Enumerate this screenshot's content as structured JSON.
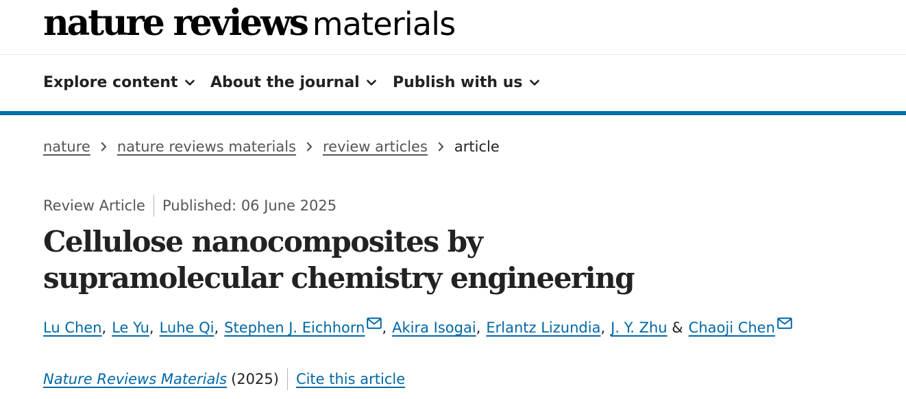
{
  "logo": {
    "main": "nature reviews",
    "sub": "materials"
  },
  "nav": [
    {
      "label": "Explore content"
    },
    {
      "label": "About the journal"
    },
    {
      "label": "Publish with us"
    }
  ],
  "breadcrumbs": [
    {
      "label": "nature"
    },
    {
      "label": "nature reviews materials"
    },
    {
      "label": "review articles"
    },
    {
      "label": "article"
    }
  ],
  "article": {
    "type": "Review Article",
    "published": "Published: 06 June 2025",
    "title": "Cellulose nanocomposites by supramolecular chemistry engineering",
    "authors": [
      {
        "name": "Lu Chen",
        "sep": ",",
        "email": false
      },
      {
        "name": "Le Yu",
        "sep": ",",
        "email": false
      },
      {
        "name": "Luhe Qi",
        "sep": ",",
        "email": false
      },
      {
        "name": "Stephen J. Eichhorn",
        "sep": ",",
        "email": true
      },
      {
        "name": "Akira Isogai",
        "sep": ",",
        "email": false
      },
      {
        "name": "Erlantz Lizundia",
        "sep": ",",
        "email": false
      },
      {
        "name": "J. Y. Zhu",
        "sep": " &",
        "email": false
      },
      {
        "name": "Chaoji Chen",
        "sep": "",
        "email": true
      }
    ],
    "journal": "Nature Reviews Materials",
    "year": "(2025)",
    "cite_label": "Cite this article"
  },
  "colors": {
    "accent": "#0070a8",
    "link": "#0067a5",
    "text": "#222222",
    "muted": "#555555"
  },
  "icons": {
    "nav_chevron": "chevron-down-icon",
    "breadcrumb_separator": "chevron-right-icon",
    "author_contact": "mail-icon"
  }
}
